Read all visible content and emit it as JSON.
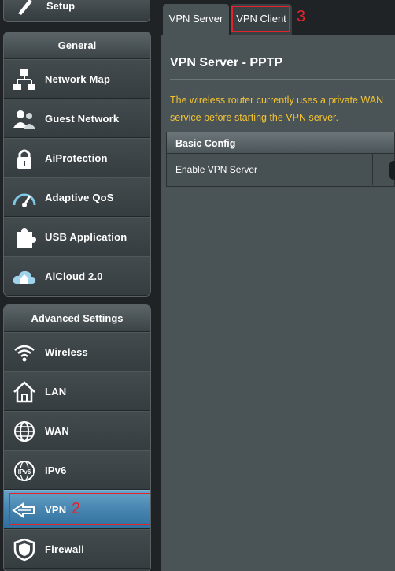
{
  "sidebar": {
    "setup_label": "Setup",
    "general": {
      "header": "General",
      "items": [
        {
          "label": "Network Map",
          "icon": "network-map-icon"
        },
        {
          "label": "Guest Network",
          "icon": "guest-network-icon"
        },
        {
          "label": "AiProtection",
          "icon": "lock-icon"
        },
        {
          "label": "Adaptive QoS",
          "icon": "gauge-icon"
        },
        {
          "label": "USB Application",
          "icon": "puzzle-icon"
        },
        {
          "label": "AiCloud 2.0",
          "icon": "cloud-home-icon"
        }
      ]
    },
    "advanced": {
      "header": "Advanced Settings",
      "items": [
        {
          "label": "Wireless",
          "icon": "wifi-icon"
        },
        {
          "label": "LAN",
          "icon": "house-icon"
        },
        {
          "label": "WAN",
          "icon": "globe-icon"
        },
        {
          "label": "IPv6",
          "icon": "ipv6-globe-icon"
        },
        {
          "label": "VPN",
          "icon": "vpn-icon",
          "active": true
        },
        {
          "label": "Firewall",
          "icon": "shield-icon"
        }
      ]
    },
    "annotation": "2"
  },
  "tabs": {
    "vpn_server": "VPN Server",
    "vpn_client": "VPN Client",
    "annotation": "3"
  },
  "main": {
    "title": "VPN Server - PPTP",
    "notice_line1": "The wireless router currently uses a private WAN",
    "notice_line2": "service before starting the VPN server.",
    "config": {
      "header": "Basic Config",
      "rows": [
        {
          "label": "Enable VPN Server"
        }
      ]
    }
  },
  "colors": {
    "accent_active": "#4a88b2",
    "annotation_red": "#e3232c",
    "notice_yellow": "#f4c430"
  }
}
